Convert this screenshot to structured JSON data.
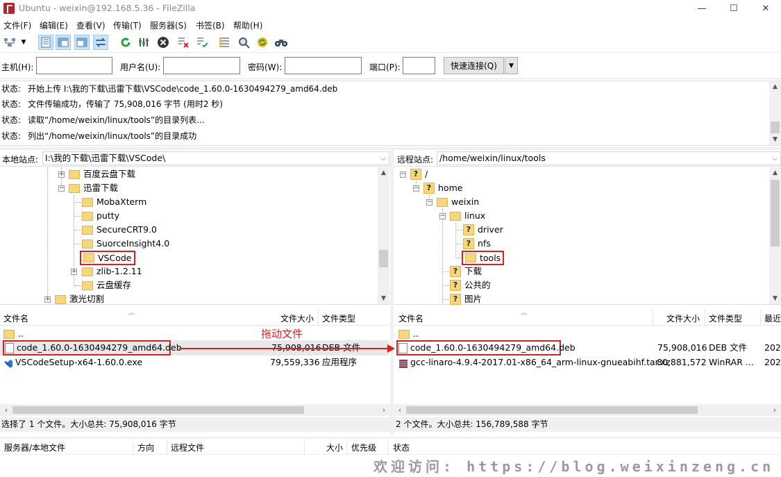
{
  "window": {
    "title": "Ubuntu - weixin@192.168.5.36 - FileZilla",
    "minimize_glyph": "—",
    "maximize_glyph": "☐",
    "close_glyph": "✕"
  },
  "menu": [
    "文件(F)",
    "编辑(E)",
    "查看(V)",
    "传输(T)",
    "服务器(S)",
    "书签(B)",
    "帮助(H)"
  ],
  "toolbar": {
    "icons": [
      "site-manager-icon",
      "toggle-log-icon",
      "toggle-local-tree-icon",
      "toggle-remote-tree-icon",
      "toggle-queue-icon",
      "refresh-icon",
      "process-queue-icon",
      "cancel-icon",
      "disconnect-icon",
      "reconnect-icon",
      "filter-icon",
      "compare-icon",
      "sync-browse-icon",
      "search-icon"
    ]
  },
  "quickconnect": {
    "host_label": "主机(H):",
    "host_value": "",
    "user_label": "用户名(U):",
    "user_value": "",
    "pass_label": "密码(W):",
    "pass_value": "",
    "port_label": "端口(P):",
    "port_value": "",
    "button": "快速连接(Q)",
    "dropdown_glyph": "▼"
  },
  "log": [
    {
      "label": "状态:",
      "text": "开始上传 I:\\我的下载\\迅雷下载\\VSCode\\code_1.60.0-1630494279_amd64.deb"
    },
    {
      "label": "状态:",
      "text": "文件传输成功，传输了 75,908,016 字节 (用时2 秒)"
    },
    {
      "label": "状态:",
      "text": "读取“/home/weixin/linux/tools”的目录列表..."
    },
    {
      "label": "状态:",
      "text": "列出“/home/weixin/linux/tools”的目录成功"
    }
  ],
  "local": {
    "site_label": "本地站点:",
    "path": "I:\\我的下载\\迅雷下载\\VSCode\\",
    "tree": [
      "百度云盘下载",
      "迅雷下载",
      "MobaXterm",
      "putty",
      "SecureCRT9.0",
      "SuorceInsight4.0",
      "VSCode",
      "zlib-1.2.11",
      "云盘缓存",
      "激光切割"
    ],
    "headers": {
      "name": "文件名",
      "size": "文件大小",
      "type": "文件类型"
    },
    "files": [
      {
        "name": "..",
        "size": "",
        "type": ""
      },
      {
        "name": "code_1.60.0-1630494279_amd64.deb",
        "size": "75,908,016",
        "type": "DEB 文件"
      },
      {
        "name": "VSCodeSetup-x64-1.60.0.exe",
        "size": "79,559,336",
        "type": "应用程序"
      }
    ],
    "status": "选择了 1 个文件。大小总共: 75,908,016 字节"
  },
  "remote": {
    "site_label": "远程站点:",
    "path": "/home/weixin/linux/tools",
    "tree": [
      "/",
      "home",
      "weixin",
      "linux",
      "driver",
      "nfs",
      "tools",
      "下载",
      "公共的",
      "图片"
    ],
    "headers": {
      "name": "文件名",
      "size": "文件大小",
      "type": "文件类型",
      "modified": "最近"
    },
    "files": [
      {
        "name": "..",
        "size": "",
        "type": "",
        "modified": ""
      },
      {
        "name": "code_1.60.0-1630494279_amd64.deb",
        "size": "75,908,016",
        "type": "DEB 文件",
        "modified": "202"
      },
      {
        "name": "gcc-linaro-4.9.4-2017.01-x86_64_arm-linux-gnueabihf.tar.xz",
        "size": "80,881,572",
        "type": "WinRAR ...",
        "modified": "202"
      }
    ],
    "status": "2 个文件。大小总共: 156,789,588 字节"
  },
  "annotation": {
    "drag_label": "拖动文件",
    "color": "#e01e1e"
  },
  "queue": {
    "headers": {
      "server": "服务器/本地文件",
      "direction": "方向",
      "remote": "远程文件",
      "size": "大小",
      "priority": "优先级",
      "status": "状态"
    }
  },
  "watermark": "欢迎访问: https://blog.weixinzeng.cn"
}
